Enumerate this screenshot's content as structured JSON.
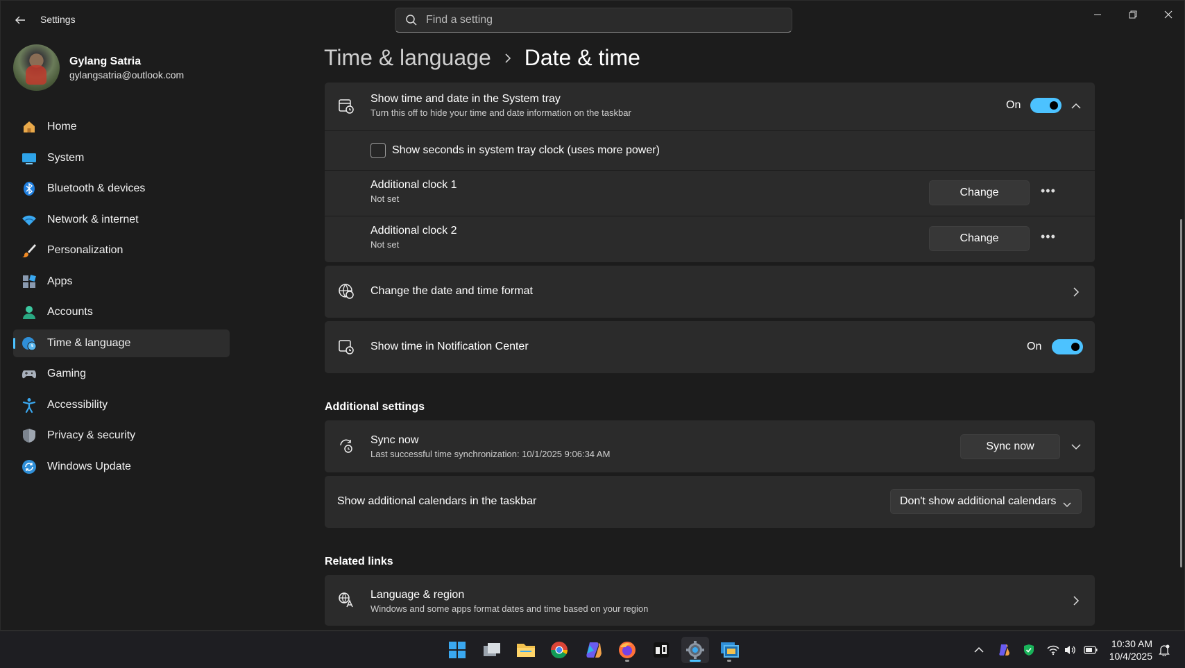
{
  "app": {
    "title": "Settings"
  },
  "search": {
    "placeholder": "Find a setting"
  },
  "user": {
    "name": "Gylang Satria",
    "email": "gylangsatria@outlook.com"
  },
  "nav": {
    "items": [
      {
        "label": "Home",
        "icon": "home-icon"
      },
      {
        "label": "System",
        "icon": "system-icon"
      },
      {
        "label": "Bluetooth & devices",
        "icon": "bluetooth-icon"
      },
      {
        "label": "Network & internet",
        "icon": "wifi-icon"
      },
      {
        "label": "Personalization",
        "icon": "brush-icon"
      },
      {
        "label": "Apps",
        "icon": "apps-icon"
      },
      {
        "label": "Accounts",
        "icon": "accounts-icon"
      },
      {
        "label": "Time & language",
        "icon": "globe-clock-icon",
        "active": true
      },
      {
        "label": "Gaming",
        "icon": "gamepad-icon"
      },
      {
        "label": "Accessibility",
        "icon": "accessibility-icon"
      },
      {
        "label": "Privacy & security",
        "icon": "shield-icon"
      },
      {
        "label": "Windows Update",
        "icon": "update-icon"
      }
    ]
  },
  "breadcrumb": {
    "parent": "Time & language",
    "current": "Date & time"
  },
  "tray_card": {
    "title": "Show time and date in the System tray",
    "subtitle": "Turn this off to hide your time and date information on the taskbar",
    "state_label": "On",
    "enabled": true,
    "seconds_label": "Show seconds in system tray clock (uses more power)",
    "seconds_checked": false,
    "clock1": {
      "title": "Additional clock 1",
      "subtitle": "Not set",
      "button": "Change"
    },
    "clock2": {
      "title": "Additional clock 2",
      "subtitle": "Not set",
      "button": "Change"
    }
  },
  "format_card": {
    "title": "Change the date and time format"
  },
  "notification_card": {
    "title": "Show time in Notification Center",
    "state_label": "On",
    "enabled": true
  },
  "additional": {
    "heading": "Additional settings",
    "sync": {
      "title": "Sync now",
      "subtitle": "Last successful time synchronization: 10/1/2025 9:06:34 AM",
      "button": "Sync now"
    },
    "calendars": {
      "label": "Show additional calendars in the taskbar",
      "selected": "Don't show additional calendars"
    }
  },
  "related": {
    "heading": "Related links",
    "language": {
      "title": "Language & region",
      "subtitle": "Windows and some apps format dates and time based on your region"
    }
  },
  "taskbar": {
    "time": "10:30 AM",
    "date": "10/4/2025",
    "apps": [
      "windows-start-icon",
      "task-view-icon",
      "file-explorer-icon",
      "chrome-icon",
      "copilot-icon",
      "firefox-icon",
      "terminal-icon",
      "settings-icon",
      "remote-desktop-icon"
    ]
  },
  "colors": {
    "accent": "#4cc2ff",
    "background": "#1c1c1c",
    "card": "#2b2b2b"
  }
}
